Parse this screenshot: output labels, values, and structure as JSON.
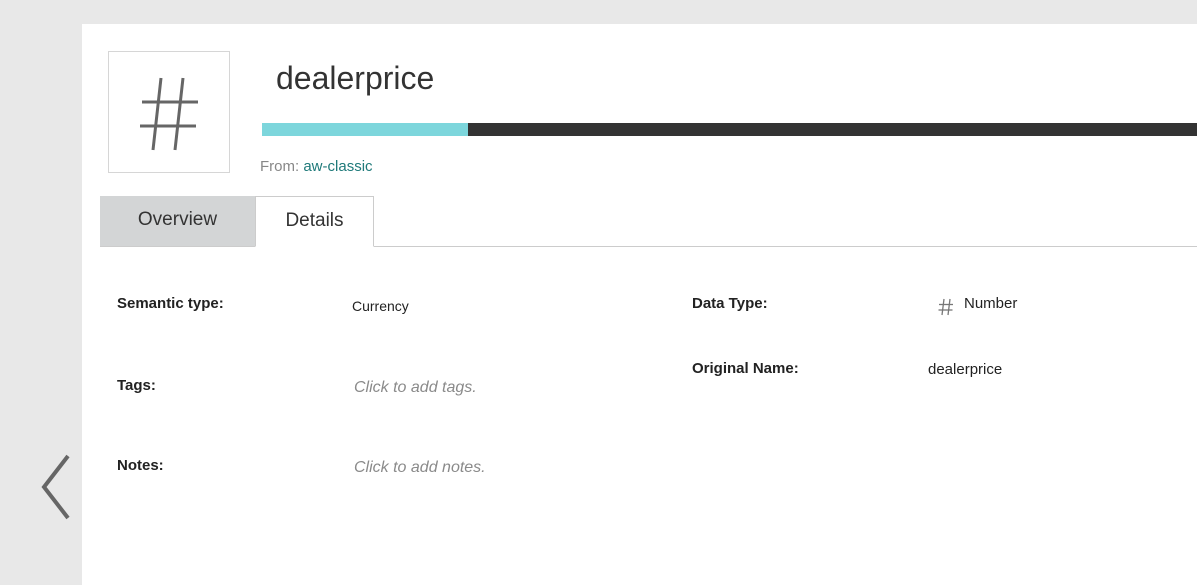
{
  "header": {
    "field_name": "dealerprice",
    "profile_fill_fraction": 0.22,
    "source_label": "From:",
    "source_value": "aw-classic"
  },
  "type_box": {
    "icon": "hash-icon"
  },
  "tabs": [
    {
      "label": "Overview",
      "active": false
    },
    {
      "label": "Details",
      "active": true
    }
  ],
  "details": {
    "semantic_type_label": "Semantic type:",
    "semantic_type_value": "Currency",
    "tags_label": "Tags:",
    "tags_placeholder": "Click to add tags.",
    "notes_label": "Notes:",
    "notes_placeholder": "Click to add notes.",
    "data_type_label": "Data Type:",
    "data_type_value": "Number",
    "data_type_icon": "hash-icon",
    "original_name_label": "Original Name:",
    "original_name_value": "dealerprice"
  },
  "nav": {
    "back_icon": "chevron-left-icon"
  },
  "colors": {
    "accent": "#7dd6dc",
    "bar_dark": "#333333",
    "link": "#1f7a7a"
  }
}
